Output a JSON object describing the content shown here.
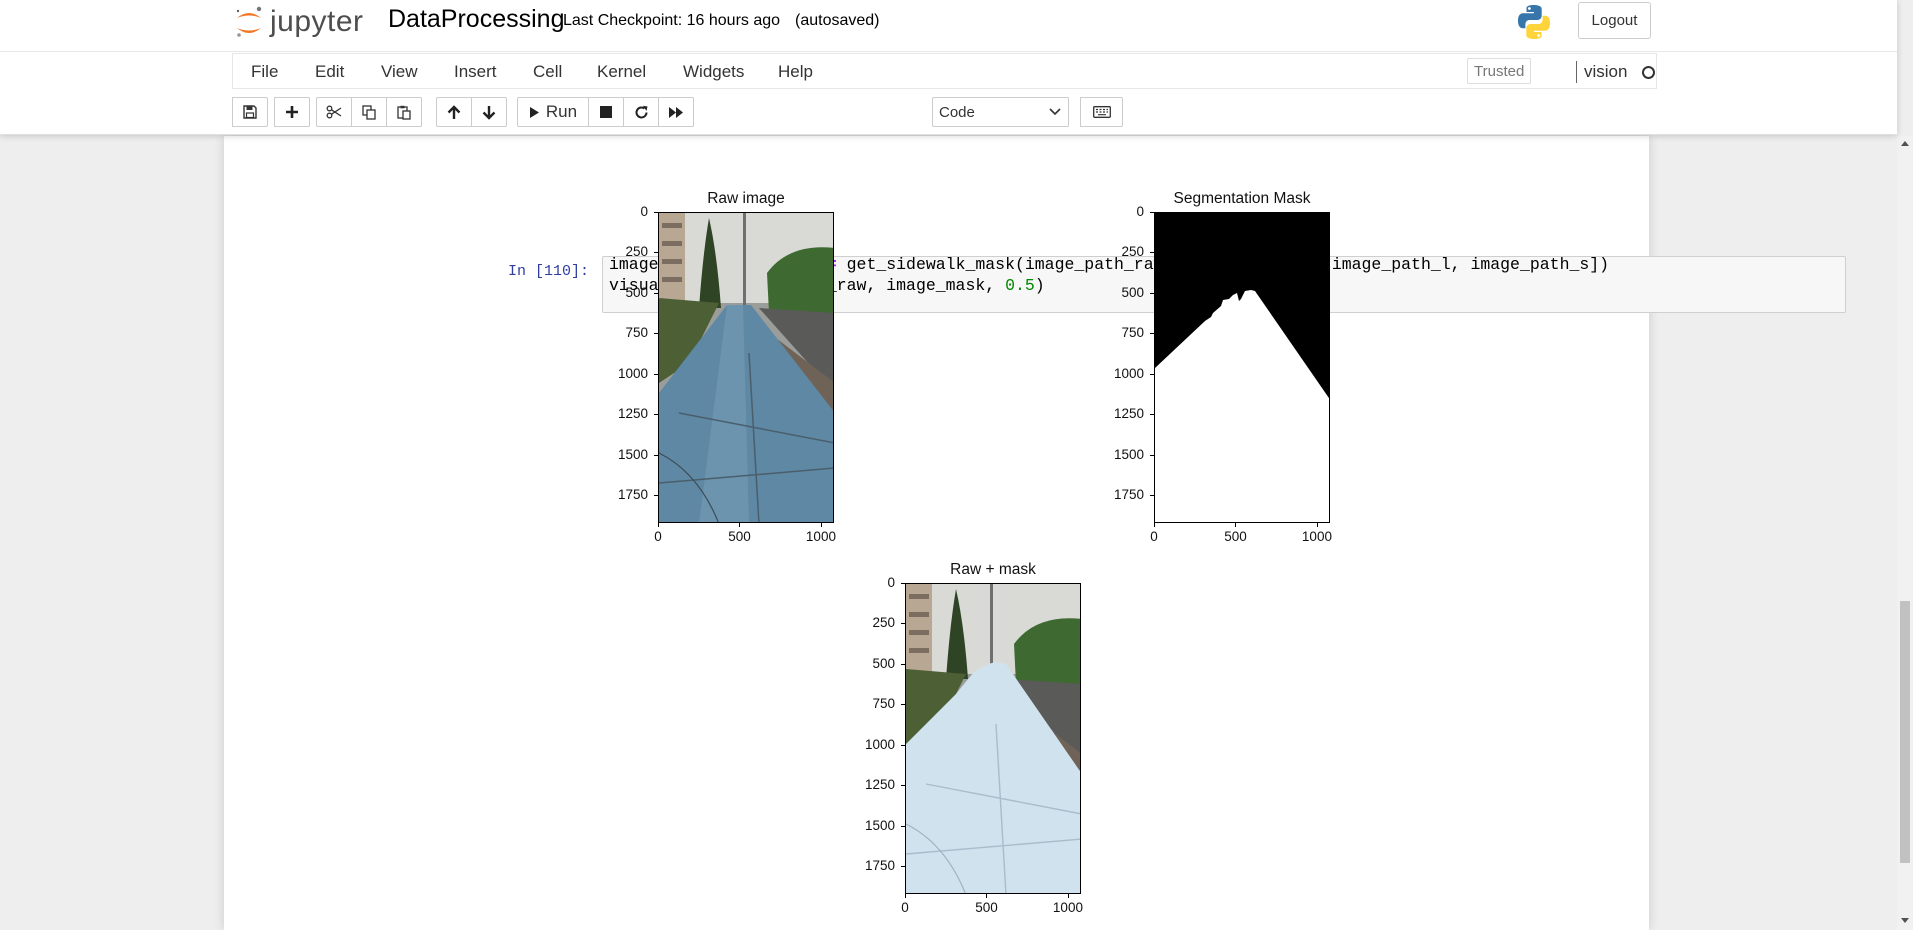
{
  "header": {
    "logo_text": "jupyter",
    "notebook_name": "DataProcessing",
    "checkpoint": "Last Checkpoint: 16 hours ago",
    "autosave": "(autosaved)",
    "logout_label": "Logout"
  },
  "menubar": {
    "items": [
      "File",
      "Edit",
      "View",
      "Insert",
      "Cell",
      "Kernel",
      "Widgets",
      "Help"
    ],
    "trusted": "Trusted",
    "kernel": "vision"
  },
  "toolbar": {
    "run_label": "Run",
    "cell_type": "Code"
  },
  "cell": {
    "prompt": "In [110]:",
    "code_line1_parts": [
      "image_raw, image_mask ",
      "=",
      " get_sidewalk_mask(image_path_raw, [image_path_r, image_path_l, image_path_s])"
    ],
    "code_line2_parts": [
      "visualize_images(image_raw, image_mask, ",
      "0.5",
      ")"
    ]
  },
  "chart_data": [
    {
      "type": "image",
      "title": "Raw image",
      "yticks": [
        "0",
        "250",
        "500",
        "750",
        "1000",
        "1250",
        "1500",
        "1750"
      ],
      "xticks": [
        "0",
        "500",
        "1000"
      ],
      "xlim": [
        0,
        1080
      ],
      "ylim": [
        0,
        1920
      ]
    },
    {
      "type": "image",
      "title": "Segmentation Mask",
      "yticks": [
        "0",
        "250",
        "500",
        "750",
        "1000",
        "1250",
        "1500",
        "1750"
      ],
      "xticks": [
        "0",
        "500",
        "1000"
      ],
      "xlim": [
        0,
        1080
      ],
      "ylim": [
        0,
        1920
      ]
    },
    {
      "type": "image",
      "title": "Raw + mask",
      "yticks": [
        "0",
        "250",
        "500",
        "750",
        "1000",
        "1250",
        "1500",
        "1750"
      ],
      "xticks": [
        "0",
        "500",
        "1000"
      ],
      "xlim": [
        0,
        1080
      ],
      "ylim": [
        0,
        1920
      ]
    }
  ]
}
